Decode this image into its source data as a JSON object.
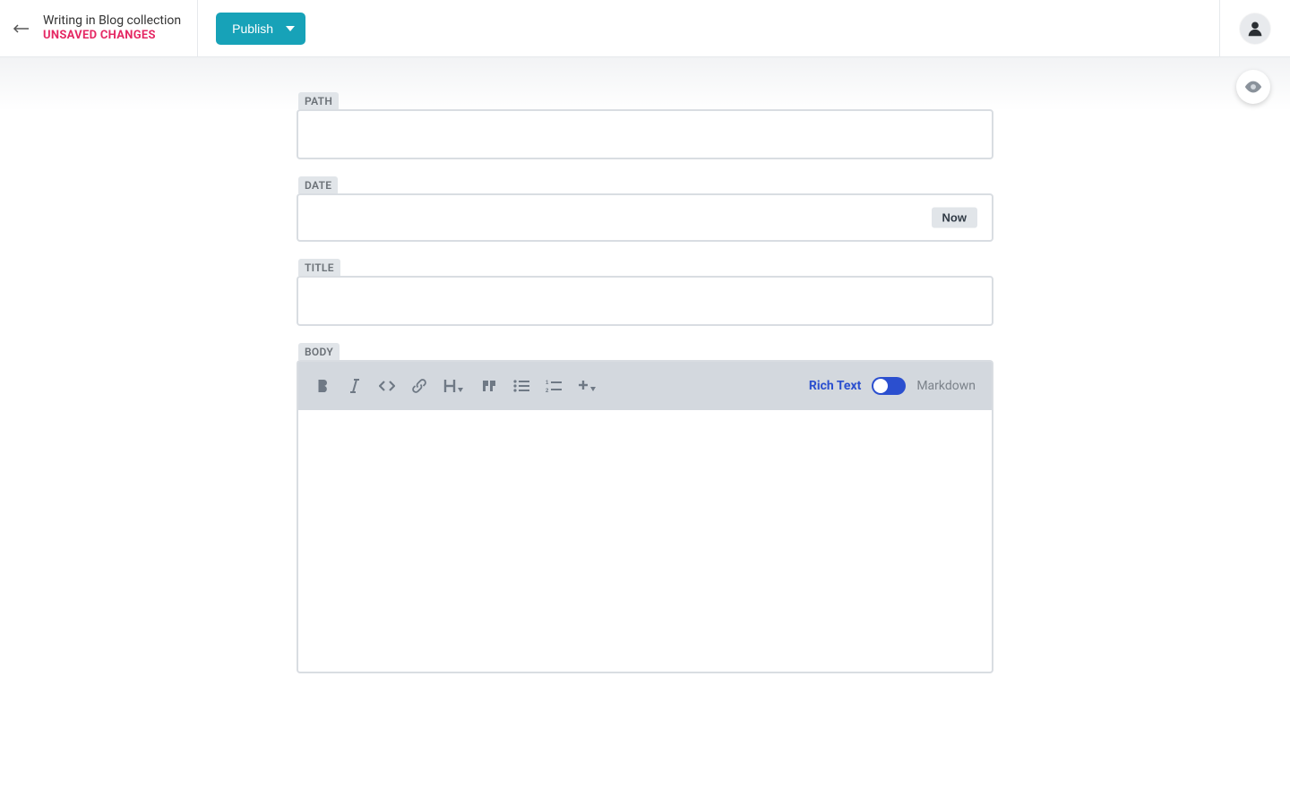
{
  "header": {
    "breadcrumb": "Writing in Blog collection",
    "status": "UNSAVED CHANGES",
    "publish_label": "Publish"
  },
  "fields": {
    "path": {
      "label": "PATH",
      "value": ""
    },
    "date": {
      "label": "DATE",
      "value": "",
      "now_label": "Now"
    },
    "title": {
      "label": "TITLE",
      "value": ""
    },
    "body": {
      "label": "BODY",
      "value": ""
    }
  },
  "editor": {
    "mode_rich": "Rich Text",
    "mode_markdown": "Markdown"
  }
}
